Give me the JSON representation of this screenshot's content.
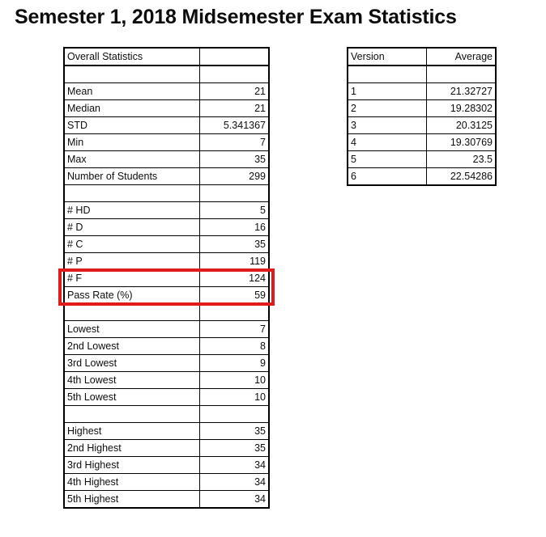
{
  "page": {
    "title": "Semester 1, 2018 Midsemester Exam Statistics"
  },
  "stats_table": {
    "header": {
      "label": "Overall Statistics",
      "value": ""
    },
    "rows": [
      {
        "label": "",
        "value": "",
        "spacer": true
      },
      {
        "label": "Mean",
        "value": "21"
      },
      {
        "label": "Median",
        "value": "21"
      },
      {
        "label": "STD",
        "value": "5.341367"
      },
      {
        "label": "Min",
        "value": "7"
      },
      {
        "label": "Max",
        "value": "35"
      },
      {
        "label": "Number of Students",
        "value": "299"
      },
      {
        "label": "",
        "value": "",
        "spacer": true
      },
      {
        "label": "# HD",
        "value": "5"
      },
      {
        "label": "# D",
        "value": "16"
      },
      {
        "label": "# C",
        "value": "35"
      },
      {
        "label": "# P",
        "value": "119"
      },
      {
        "label": "# F",
        "value": "124"
      },
      {
        "label": "Pass Rate (%)",
        "value": "59"
      },
      {
        "label": "",
        "value": "",
        "spacer": true
      },
      {
        "label": "Lowest",
        "value": "7"
      },
      {
        "label": "2nd Lowest",
        "value": "8"
      },
      {
        "label": "3rd Lowest",
        "value": "9"
      },
      {
        "label": "4th Lowest",
        "value": "10"
      },
      {
        "label": "5th Lowest",
        "value": "10"
      },
      {
        "label": "",
        "value": "",
        "spacer": true
      },
      {
        "label": "Highest",
        "value": "35"
      },
      {
        "label": "2nd Highest",
        "value": "35"
      },
      {
        "label": "3rd Highest",
        "value": "34"
      },
      {
        "label": "4th Highest",
        "value": "34"
      },
      {
        "label": "5th Highest",
        "value": "34"
      }
    ]
  },
  "version_table": {
    "header": {
      "label": "Version",
      "value": "Average"
    },
    "rows": [
      {
        "label": "",
        "value": "",
        "spacer": true
      },
      {
        "label": "1",
        "value": "21.32727"
      },
      {
        "label": "2",
        "value": "19.28302"
      },
      {
        "label": "3",
        "value": "20.3125"
      },
      {
        "label": "4",
        "value": "19.30769"
      },
      {
        "label": "5",
        "value": "23.5"
      },
      {
        "label": "6",
        "value": "22.54286"
      }
    ]
  },
  "annotation": {
    "name": "pass-rate-highlight",
    "color": "#e01b1b",
    "covers": [
      "# F",
      "Pass Rate (%)"
    ]
  },
  "chart_data": {
    "type": "table",
    "title": "Semester 1, 2018 Midsemester Exam Statistics",
    "tables": [
      {
        "name": "Overall Statistics",
        "columns": [
          "Overall Statistics",
          ""
        ],
        "rows": [
          [
            "Mean",
            21
          ],
          [
            "Median",
            21
          ],
          [
            "STD",
            5.341367
          ],
          [
            "Min",
            7
          ],
          [
            "Max",
            35
          ],
          [
            "Number of Students",
            299
          ],
          [
            "# HD",
            5
          ],
          [
            "# D",
            16
          ],
          [
            "# C",
            35
          ],
          [
            "# P",
            119
          ],
          [
            "# F",
            124
          ],
          [
            "Pass Rate (%)",
            59
          ],
          [
            "Lowest",
            7
          ],
          [
            "2nd Lowest",
            8
          ],
          [
            "3rd Lowest",
            9
          ],
          [
            "4th Lowest",
            10
          ],
          [
            "5th Lowest",
            10
          ],
          [
            "Highest",
            35
          ],
          [
            "2nd Highest",
            35
          ],
          [
            "3rd Highest",
            34
          ],
          [
            "4th Highest",
            34
          ],
          [
            "5th Highest",
            34
          ]
        ]
      },
      {
        "name": "Version Averages",
        "columns": [
          "Version",
          "Average"
        ],
        "rows": [
          [
            1,
            21.32727
          ],
          [
            2,
            19.28302
          ],
          [
            3,
            20.3125
          ],
          [
            4,
            19.30769
          ],
          [
            5,
            23.5
          ],
          [
            6,
            22.54286
          ]
        ]
      }
    ]
  }
}
